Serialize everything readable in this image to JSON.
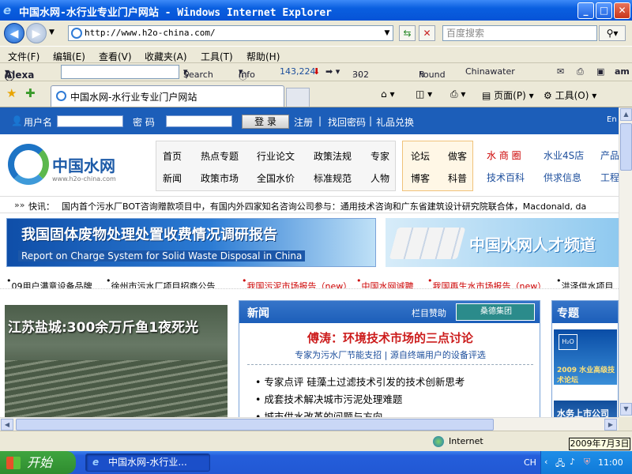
{
  "window": {
    "title": "中国水网-水行业专业门户网站 - Windows Internet Explorer",
    "minimize": "_",
    "maximize": "□",
    "close": "✕"
  },
  "address": {
    "url": "http://www.h2o-china.com/",
    "search_placeholder": "百度搜索"
  },
  "menu": [
    "文件(F)",
    "编辑(E)",
    "查看(V)",
    "收藏夹(A)",
    "工具(T)",
    "帮助(H)"
  ],
  "alexa": {
    "brand": "Alexa",
    "search_label": "Search",
    "info_label": "Info",
    "rank": "143,224",
    "code": "302",
    "found": "Found",
    "site_name": "Chinawater",
    "am": "am"
  },
  "tab": {
    "title": "中国水网-水行业专业门户网站",
    "page_menu": "页面(P)",
    "tools_menu": "工具(O)"
  },
  "site": {
    "login": {
      "user_label": "用户名",
      "pass_label": "密  码",
      "login_button": "登 录",
      "register": "注册",
      "find_pass": "找回密码",
      "gift": "礼品兑换",
      "lang": "En"
    },
    "logo": {
      "name": "中国水网",
      "url": "www.h2o-china.com"
    },
    "nav1": [
      "首页",
      "热点专题",
      "行业论文",
      "政策法规",
      "专家",
      "新闻",
      "政策市场",
      "全国水价",
      "标准规范",
      "人物"
    ],
    "nav2": [
      "论坛",
      "做客",
      "博客",
      "科普"
    ],
    "nav3": [
      "水 商 圈",
      "水业4S店",
      "产品",
      "技术百科",
      "供求信息",
      "工程"
    ],
    "ticker": {
      "label": "快讯：",
      "text": "国内首个污水厂BOT咨询赠款项目中，有国内外四家知名咨询公司参与：通用技术咨询和广东省建筑设计研究院联合体，Macdonald, da"
    },
    "banner1": {
      "title": "我国固体废物处理处置收费情况调研报告",
      "subtitle": "Report on Charge System for Solid Waste Disposal in China"
    },
    "banner2": {
      "title": "中国水网人才频道"
    },
    "links": [
      "09用户满意设备品牌",
      "徐州市污水厂项目招商公告",
      "我国污泥市场报告（new）",
      "中国水网诚聘",
      "我国再生水市场报告（new）",
      "洪泽供水项目"
    ],
    "photo_caption": "江苏盐城:300余万斤鱼1夜死光",
    "news": {
      "header": "新闻",
      "sponsor_label": "栏目赞助",
      "sponsor_name": "桑德集团",
      "headline": "傅涛：环境技术市场的三点讨论",
      "sub": "专家为污水厂节能支招 | 源自终端用户的设备评选",
      "items": [
        "专家点评 硅藻土过滤技术引发的技术创新思考",
        "成套技术解决城市污泥处理难题",
        "城市供水改革的问题与方向"
      ]
    },
    "topic": {
      "header": "专题",
      "thumb1": "2009 水业高级技术论坛",
      "thumb2": "水务上市公司"
    }
  },
  "status": {
    "zone": "Internet",
    "date_tooltip": "2009年7月3日"
  },
  "taskbar": {
    "start": "开始",
    "task_title": "中国水网-水行业...",
    "ime": "CH",
    "clock": "11:00"
  }
}
